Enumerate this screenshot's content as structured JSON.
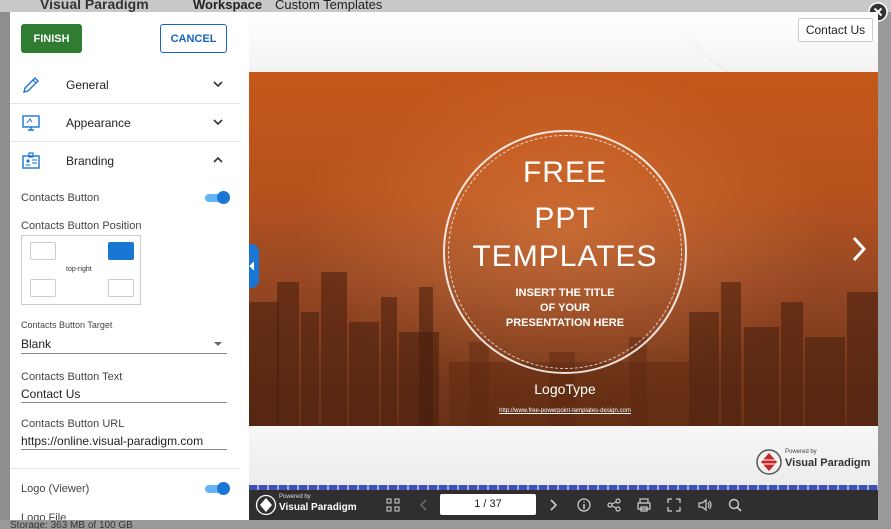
{
  "background": {
    "logo_text": "Visual Paradigm",
    "tabs": [
      "Workspace",
      "Custom Templates"
    ],
    "storage_text": "Storage: 363 MB of 100 GB"
  },
  "panel": {
    "finish_label": "FINISH",
    "cancel_label": "CANCEL",
    "sections": [
      {
        "label": "General",
        "icon": "pencil-icon",
        "expanded": false
      },
      {
        "label": "Appearance",
        "icon": "monitor-icon",
        "expanded": false
      },
      {
        "label": "Branding",
        "icon": "id-badge-icon",
        "expanded": true
      }
    ],
    "contacts_button_label": "Contacts Button",
    "contacts_button_on": true,
    "position_label": "Contacts Button Position",
    "position_value": "top-right",
    "target_label": "Contacts Button Target",
    "target_value": "Blank",
    "text_label": "Contacts Button Text",
    "text_value": "Contact Us",
    "url_label": "Contacts Button URL",
    "url_value": "https://online.visual-paradigm.com",
    "logo_viewer_label": "Logo (Viewer)",
    "logo_viewer_on": true,
    "logo_file_label": "Logo File"
  },
  "viewer": {
    "contact_button_label": "Contact Us",
    "slide": {
      "line1": "FREE",
      "line2": "PPT",
      "line3": "TEMPLATES",
      "sub1": "INSERT THE TITLE",
      "sub2": "OF YOUR",
      "sub3": "PRESENTATION HERE",
      "logo_type": "LogoType",
      "url": "http://www.free-powerpoint-templates-design.com",
      "powered_by": "Powered by",
      "brand_name": "Visual Paradigm"
    },
    "toolbar": {
      "powered_by": "Powered by",
      "brand_name": "Visual Paradigm",
      "page_indicator": "1 / 37"
    }
  },
  "colors": {
    "finish_bg": "#2e7d32",
    "accent_blue": "#1976d2",
    "slide_orange": "#c4581a",
    "toolbar_bg": "#2f2f2f"
  }
}
